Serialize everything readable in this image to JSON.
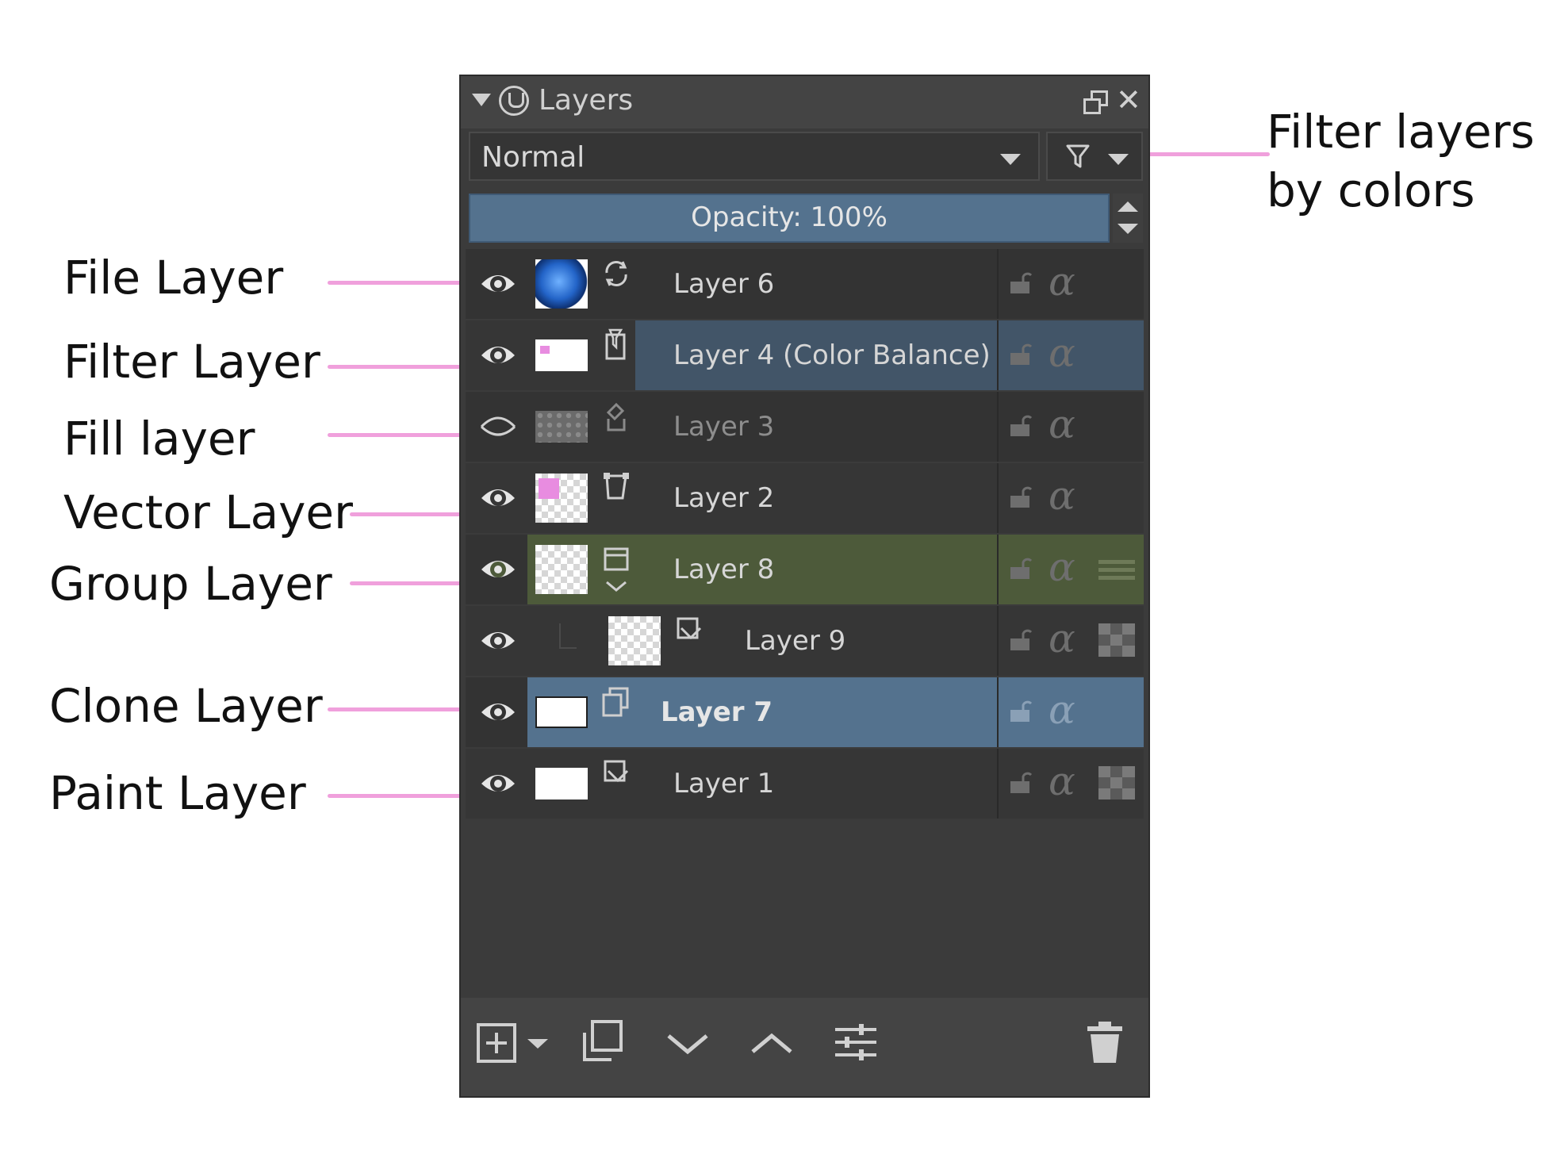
{
  "annotations": {
    "file_layer": "File Layer",
    "filter_layer": "Filter Layer",
    "fill_layer": "Fill layer",
    "vector_layer": "Vector Layer",
    "group_layer": "Group Layer",
    "clone_layer": "Clone Layer",
    "paint_layer": "Paint Layer",
    "filter_by_colors_line1": "Filter layers",
    "filter_by_colors_line2": "by colors"
  },
  "docker": {
    "title": "Layers",
    "blend_mode": "Normal",
    "opacity_label": "Opacity:  100%"
  },
  "layers": [
    {
      "name": "Layer 6",
      "type": "file-layer",
      "visible": true,
      "label_color": ""
    },
    {
      "name": "Layer 4 (Color Balance)",
      "type": "filter-layer",
      "visible": true,
      "label_color": "#425568"
    },
    {
      "name": "Layer 3",
      "type": "fill-layer",
      "visible": false,
      "label_color": ""
    },
    {
      "name": "Layer 2",
      "type": "vector-layer",
      "visible": true,
      "label_color": ""
    },
    {
      "name": "Layer 8",
      "type": "group-layer",
      "visible": true,
      "label_color": "#4d5a3a"
    },
    {
      "name": "Layer 9",
      "type": "paint-layer",
      "visible": true,
      "label_color": ""
    },
    {
      "name": "Layer 7",
      "type": "clone-layer",
      "visible": true,
      "label_color": "#54728e",
      "selected": true
    },
    {
      "name": "Layer 1",
      "type": "paint-layer",
      "visible": true,
      "label_color": ""
    }
  ],
  "colors": {
    "annotation_leader": "#f0a0dc",
    "selected_row": "#54728e",
    "group_label": "#4d5a3a",
    "filter_label": "#425568"
  },
  "bottom_toolbar": [
    "add-layer-icon",
    "duplicate-layer-icon",
    "move-layer-down-icon",
    "move-layer-up-icon",
    "layer-properties-icon",
    "delete-layer-icon"
  ]
}
